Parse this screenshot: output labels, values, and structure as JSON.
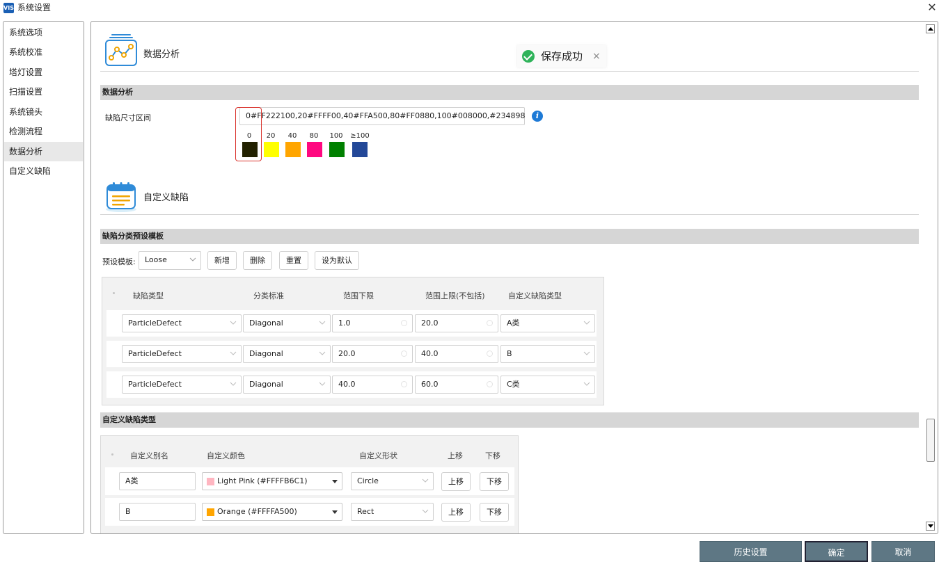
{
  "window": {
    "title": "系统设置",
    "logo_text": "VIS"
  },
  "sidebar": {
    "items": [
      {
        "label": "系统选项"
      },
      {
        "label": "系统校准"
      },
      {
        "label": "塔灯设置"
      },
      {
        "label": "扫描设置"
      },
      {
        "label": "系统镜头"
      },
      {
        "label": "检测流程"
      },
      {
        "label": "数据分析",
        "active": true
      },
      {
        "label": "自定义缺陷"
      }
    ]
  },
  "toast": {
    "text": "保存成功",
    "close": "×"
  },
  "data_analysis": {
    "heading": "数据分析",
    "band": "数据分析",
    "size_range_label": "缺陷尺寸区间",
    "size_range_value": "0#FF222100,20#FFFF00,40#FFA500,80#FF0880,100#008000,#234898",
    "info_icon": "i",
    "swatches": [
      {
        "label": "0",
        "color": "#222100"
      },
      {
        "label": "20",
        "color": "#FFFF00"
      },
      {
        "label": "40",
        "color": "#FFA500"
      },
      {
        "label": "80",
        "color": "#FF0880"
      },
      {
        "label": "100",
        "color": "#008000"
      },
      {
        "label": "≥100",
        "color": "#234898"
      }
    ]
  },
  "custom_defect": {
    "heading": "自定义缺陷",
    "template_band": "缺陷分类预设模板",
    "preset_label": "预设模板:",
    "preset_value": "Loose",
    "buttons": {
      "add": "新增",
      "delete": "删除",
      "reset": "重置",
      "set_default": "设为默认"
    },
    "columns": [
      "缺陷类型",
      "分类标准",
      "范围下限",
      "范围上限(不包括)",
      "自定义缺陷类型"
    ],
    "rows": [
      {
        "type": "ParticleDefect",
        "standard": "Diagonal",
        "min": "1.0",
        "max": "20.0",
        "custom": "A类"
      },
      {
        "type": "ParticleDefect",
        "standard": "Diagonal",
        "min": "20.0",
        "max": "40.0",
        "custom": "B"
      },
      {
        "type": "ParticleDefect",
        "standard": "Diagonal",
        "min": "40.0",
        "max": "60.0",
        "custom": "C类"
      }
    ],
    "types_band": "自定义缺陷类型",
    "type_columns": [
      "自定义别名",
      "自定义颜色",
      "自定义形状",
      "上移",
      "下移"
    ],
    "type_rows": [
      {
        "alias": "A类",
        "color_label": "Light Pink (#FFFFB6C1)",
        "swatch": "#FFB6C1",
        "shape": "Circle",
        "up": "上移",
        "down": "下移"
      },
      {
        "alias": "B",
        "color_label": "Orange (#FFFFA500)",
        "swatch": "#FFA500",
        "shape": "Rect",
        "up": "上移",
        "down": "下移"
      }
    ]
  },
  "footer": {
    "history": "历史设置",
    "ok": "确定",
    "cancel": "取消"
  }
}
